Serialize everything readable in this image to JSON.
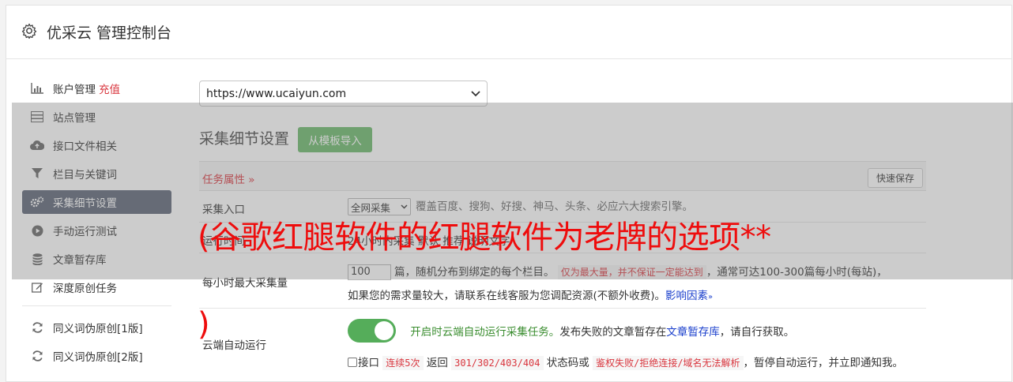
{
  "header": {
    "title": "优采云 管理控制台",
    "icon": "gear-icon"
  },
  "sidebar": {
    "items": [
      {
        "label": "账户管理",
        "badge": "充值",
        "icon": "bar-chart-icon"
      },
      {
        "label": "站点管理",
        "icon": "server-icon"
      },
      {
        "label": "接口文件相关",
        "icon": "cloud-upload-icon"
      },
      {
        "label": "栏目与关键词",
        "icon": "filter-icon"
      },
      {
        "label": "采集细节设置",
        "icon": "cogs-icon",
        "active": true
      },
      {
        "label": "手动运行测试",
        "icon": "play-circle-icon"
      },
      {
        "label": "文章暂存库",
        "icon": "database-icon"
      },
      {
        "label": "深度原创任务",
        "icon": "edit-icon"
      },
      {
        "label": "同义词伪原创[1版]",
        "icon": "refresh-icon"
      },
      {
        "label": "同义词伪原创[2版]",
        "icon": "refresh-icon"
      }
    ]
  },
  "site_select": {
    "value": "https://www.ucaiyun.com"
  },
  "section": {
    "title": "采集细节设置",
    "import_button": "从模板导入"
  },
  "task_props": {
    "label": "任务属性 »",
    "save_button": "快速保存"
  },
  "rows": {
    "entry": {
      "label": "采集入口",
      "select_value": "全网采集",
      "hint": "覆盖百度、搜狗、好搜、神马、头条、必应六大搜索引擎。"
    },
    "runtime": {
      "label": "运行时间",
      "hint": "24小时内采集 默认 推荐 说明文字"
    },
    "max_per_hour": {
      "label": "每小时最大采集量",
      "value": "100",
      "text1": "篇，随机分布到绑定的每个栏目。",
      "highlight": "仅为最大量，并不保证一定能达到",
      "text2": "，通常可达100-300篇每小时(每站)，",
      "text3": "如果您的需求量较大，请联系在线客服为您调配资源(不额外收费)。",
      "link": "影响因素"
    },
    "cloud_auto": {
      "label": "云端自动运行",
      "toggle_on": true,
      "green_text": "开启时云端自动运行采集任务。",
      "text1": "发布失败的文章暂存在",
      "link": "文章暂存库",
      "text2": "，请自行获取。",
      "check_prefix": "接口",
      "code1": "连续5次",
      "mid1": "返回",
      "code2": "301/302/403/404",
      "mid2": "状态码或",
      "code3": "鉴权失败/拒绝连接/域名无法解析",
      "tail": "，暂停自动运行，并立即通知我。"
    }
  },
  "watermark": {
    "line1": "(谷歌红腿软件的红腿软件为老牌的选项**",
    "line2": ")"
  },
  "colors": {
    "accent_red": "#d9363e",
    "active_nav": "#5b6375",
    "green_button": "#6ab96a",
    "toggle_green": "#55ad5a"
  }
}
